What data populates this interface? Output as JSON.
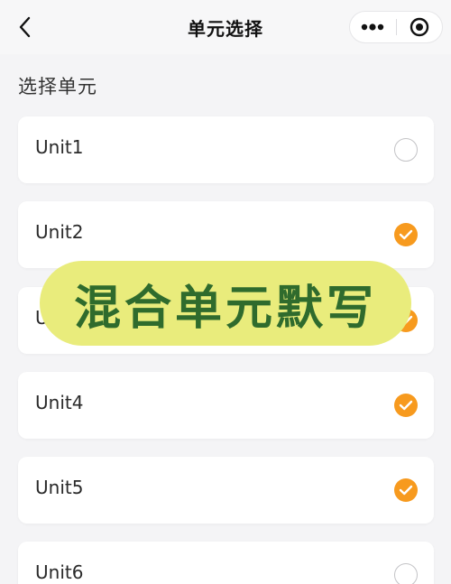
{
  "nav": {
    "title": "单元选择",
    "back_icon": "chevron-left-icon",
    "more_icon": "more-dots-icon",
    "close_icon": "target-circle-icon"
  },
  "section_title": "选择单元",
  "units": [
    {
      "label": "Unit1",
      "checked": false
    },
    {
      "label": "Unit2",
      "checked": true
    },
    {
      "label": "Unit3",
      "checked": true
    },
    {
      "label": "Unit4",
      "checked": true
    },
    {
      "label": "Unit5",
      "checked": true
    },
    {
      "label": "Unit6",
      "checked": false
    }
  ],
  "overlay": {
    "text": "混合单元默写"
  },
  "colors": {
    "accent": "#f79a1e",
    "overlay_bg": "#e9ec7c",
    "overlay_text": "#2f6b2d",
    "page_bg": "#f4f4f6"
  }
}
